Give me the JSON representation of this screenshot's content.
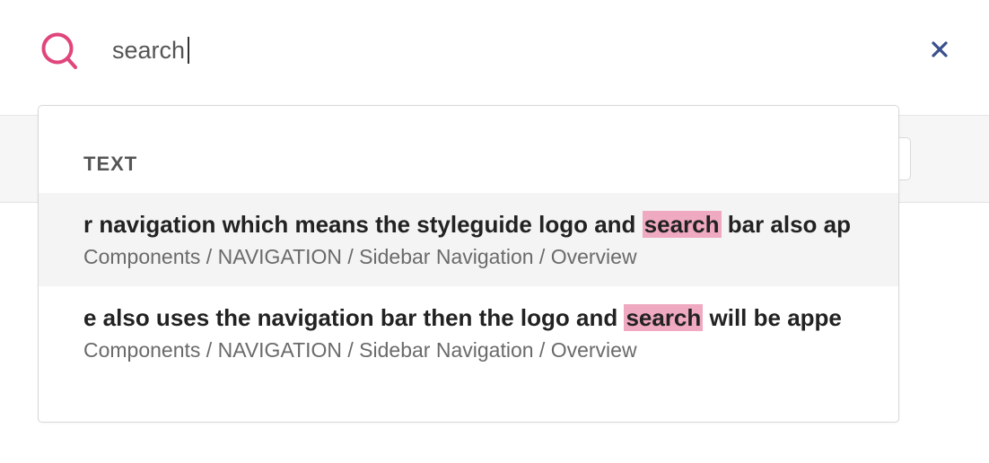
{
  "search": {
    "value": "search",
    "icon": "search-icon",
    "close_icon": "close-icon",
    "accent_color": "#e0457b",
    "close_color": "#3a4f8c"
  },
  "dropdown": {
    "section_label": "TEXT",
    "results": [
      {
        "before": "r navigation which means the styleguide logo and ",
        "match": "search",
        "after": " bar also ap",
        "path": "Components / NAVIGATION / Sidebar Navigation / Overview",
        "active": true
      },
      {
        "before": "e also uses the navigation bar then the logo and ",
        "match": "search",
        "after": " will be appe",
        "path": "Components / NAVIGATION / Sidebar Navigation / Overview",
        "active": false
      }
    ],
    "highlight_color": "#efa9c1"
  }
}
